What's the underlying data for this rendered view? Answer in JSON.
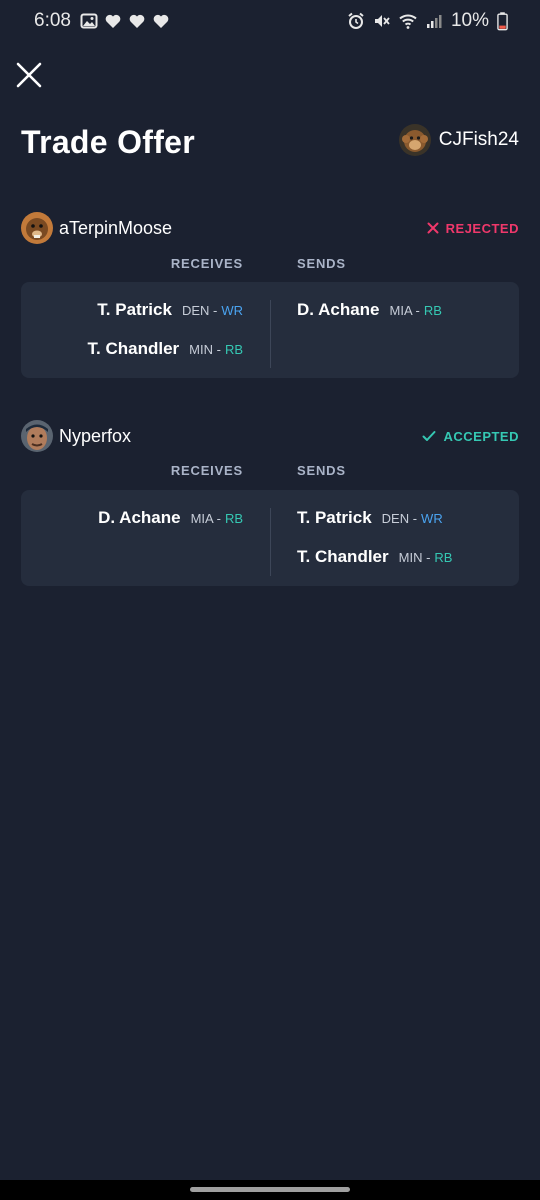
{
  "status_bar": {
    "time": "6:08",
    "battery": "10%",
    "left_icons": [
      "image-icon",
      "heart-icon",
      "heart-icon",
      "heart-icon"
    ],
    "right_icons": [
      "alarm-icon",
      "mute-icon",
      "wifi-icon",
      "signal-icon",
      "battery-icon"
    ]
  },
  "header": {
    "title": "Trade Offer",
    "owner": "CJFish24"
  },
  "parties": [
    {
      "user": "aTerpinMoose",
      "status": "REJECTED",
      "receives_label": "RECEIVES",
      "sends_label": "SENDS",
      "receives": [
        {
          "name": "T. Patrick",
          "team": "DEN -",
          "pos": "WR"
        },
        {
          "name": "T. Chandler",
          "team": "MIN -",
          "pos": "RB"
        }
      ],
      "sends": [
        {
          "name": "D. Achane",
          "team": "MIA -",
          "pos": "RB"
        }
      ]
    },
    {
      "user": "Nyperfox",
      "status": "ACCEPTED",
      "receives_label": "RECEIVES",
      "sends_label": "SENDS",
      "receives": [
        {
          "name": "D. Achane",
          "team": "MIA -",
          "pos": "RB"
        }
      ],
      "sends": [
        {
          "name": "T. Patrick",
          "team": "DEN -",
          "pos": "WR"
        },
        {
          "name": "T. Chandler",
          "team": "MIN -",
          "pos": "RB"
        }
      ]
    }
  ],
  "colors": {
    "background": "#1b2130",
    "card": "#252d3d",
    "rejected": "#f0386b",
    "accepted": "#35c8b3",
    "wr": "#4aa3f0",
    "rb": "#35c8b3"
  }
}
